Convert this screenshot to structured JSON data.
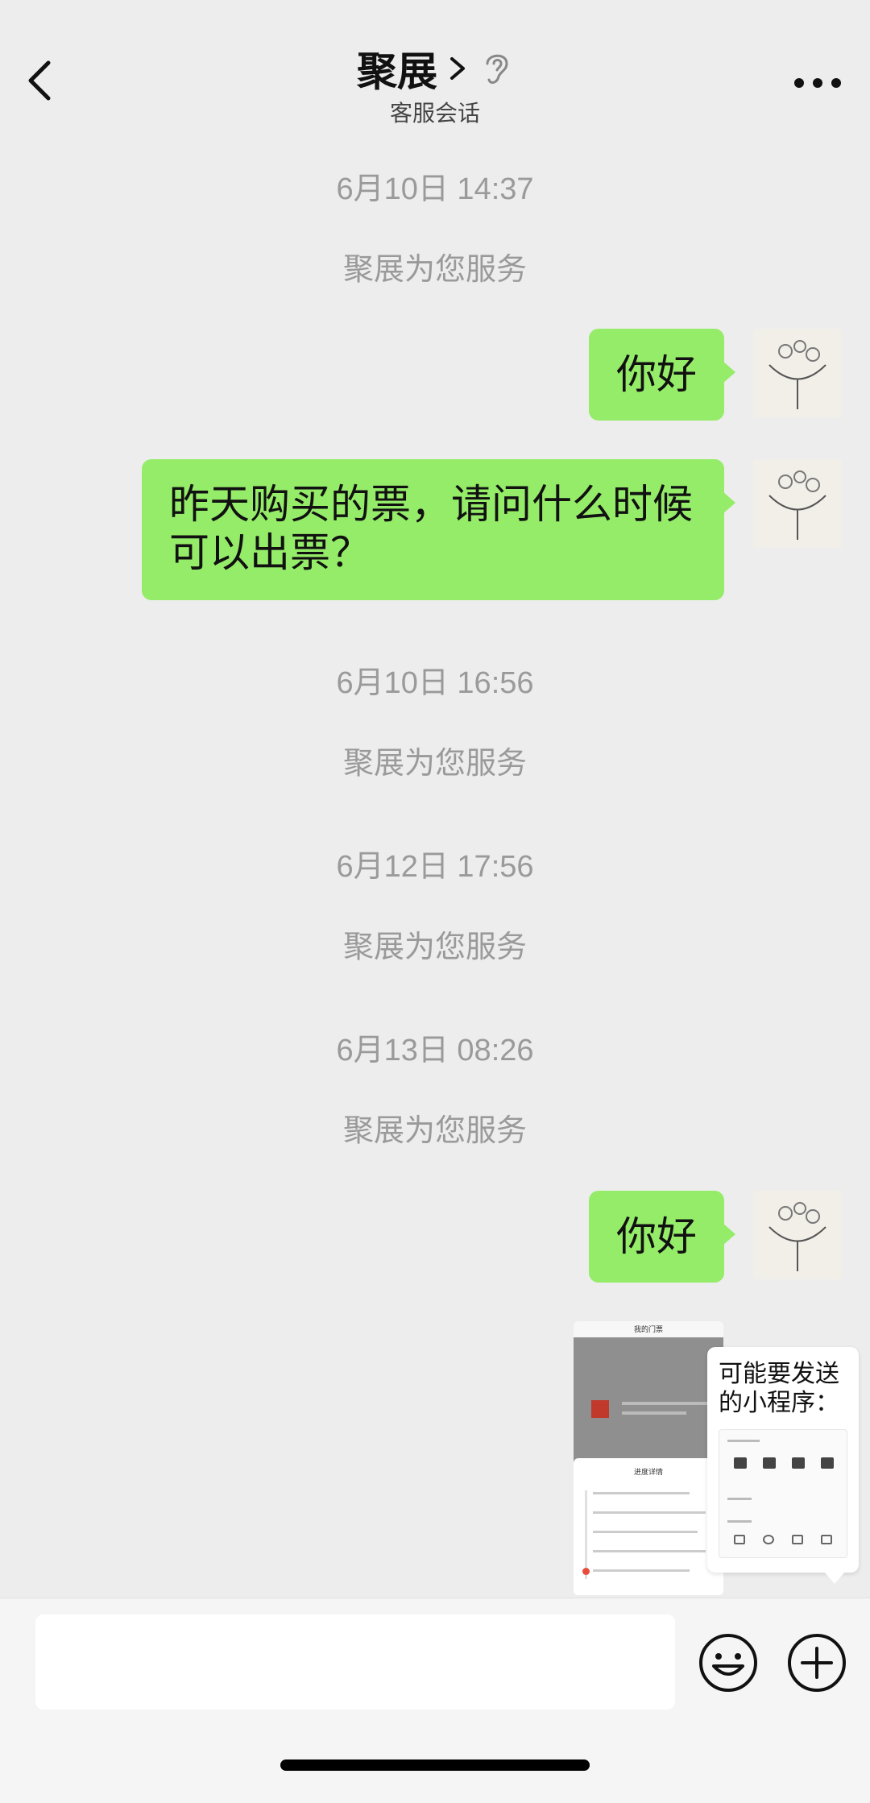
{
  "header": {
    "title": "聚展",
    "subtitle": "客服会话"
  },
  "messages": {
    "t1": "6月10日 14:37",
    "n1": "聚展为您服务",
    "m1": "你好",
    "m2_line1": "昨天购买的票，请问什么时候",
    "m2_line2": "可以出票？",
    "t2": "6月10日 16:56",
    "n2": "聚展为您服务",
    "t3": "6月12日 17:56",
    "n3": "聚展为您服务",
    "t4": "6月13日 08:26",
    "n4": "聚展为您服务",
    "m3": "你好"
  },
  "thumbnail": {
    "top_title": "我的门票",
    "sheet_title": "进度详情"
  },
  "popup": {
    "title": "可能要发送的小程序："
  },
  "colors": {
    "bubble_green": "#95ec69",
    "background": "#ededed",
    "system_text": "#9a9a9a"
  },
  "icons": {
    "back": "chevron-left-icon",
    "more": "more-dots-icon",
    "ear": "ear-icon",
    "emoji": "emoji-icon",
    "plus": "plus-circle-icon"
  }
}
